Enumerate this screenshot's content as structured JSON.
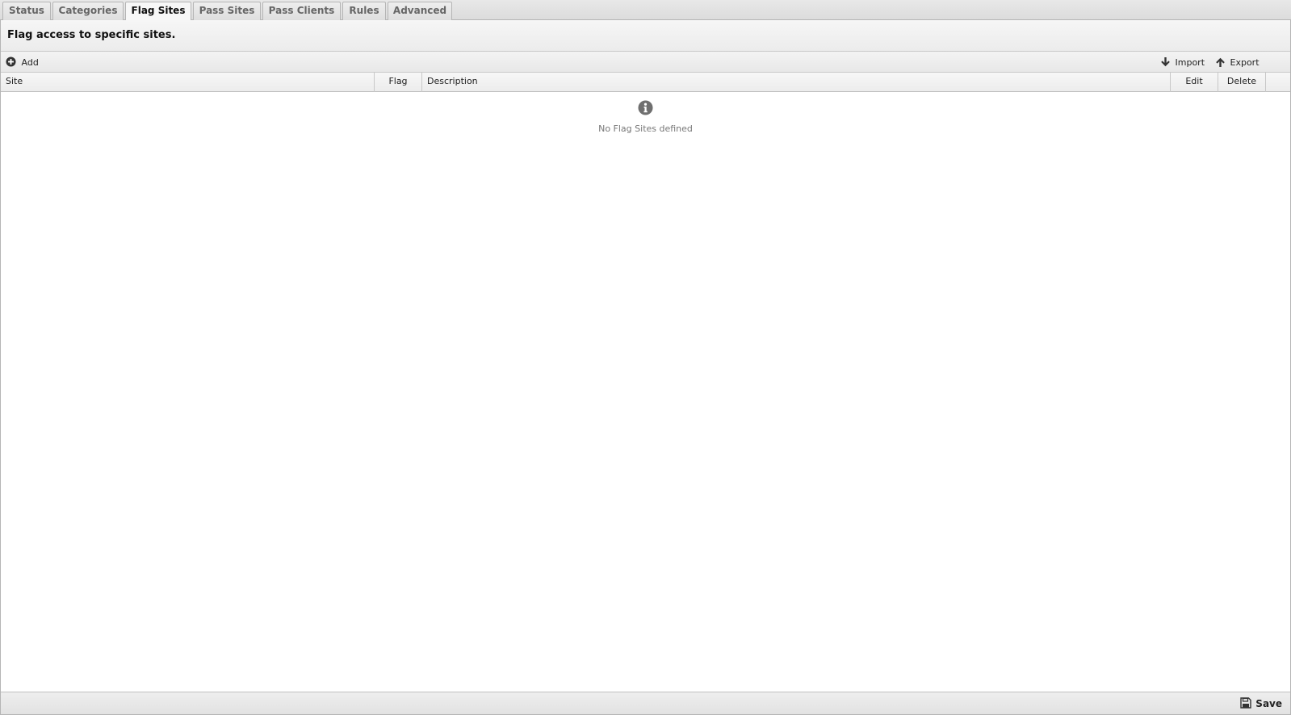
{
  "tabs": [
    {
      "label": "Status"
    },
    {
      "label": "Categories"
    },
    {
      "label": "Flag Sites",
      "active": true
    },
    {
      "label": "Pass Sites"
    },
    {
      "label": "Pass Clients"
    },
    {
      "label": "Rules"
    },
    {
      "label": "Advanced"
    }
  ],
  "header": {
    "title": "Flag access to specific sites."
  },
  "toolbar": {
    "add_label": "Add",
    "add_icon": "plus-circle-icon",
    "import_label": "Import",
    "import_icon": "arrow-down-icon",
    "export_label": "Export",
    "export_icon": "arrow-up-icon"
  },
  "grid": {
    "columns": [
      "Site",
      "Flag",
      "Description",
      "Edit",
      "Delete"
    ],
    "empty_message": "No Flag Sites defined",
    "empty_icon": "info-icon"
  },
  "footer": {
    "save_label": "Save",
    "save_icon": "floppy-disk-icon"
  }
}
